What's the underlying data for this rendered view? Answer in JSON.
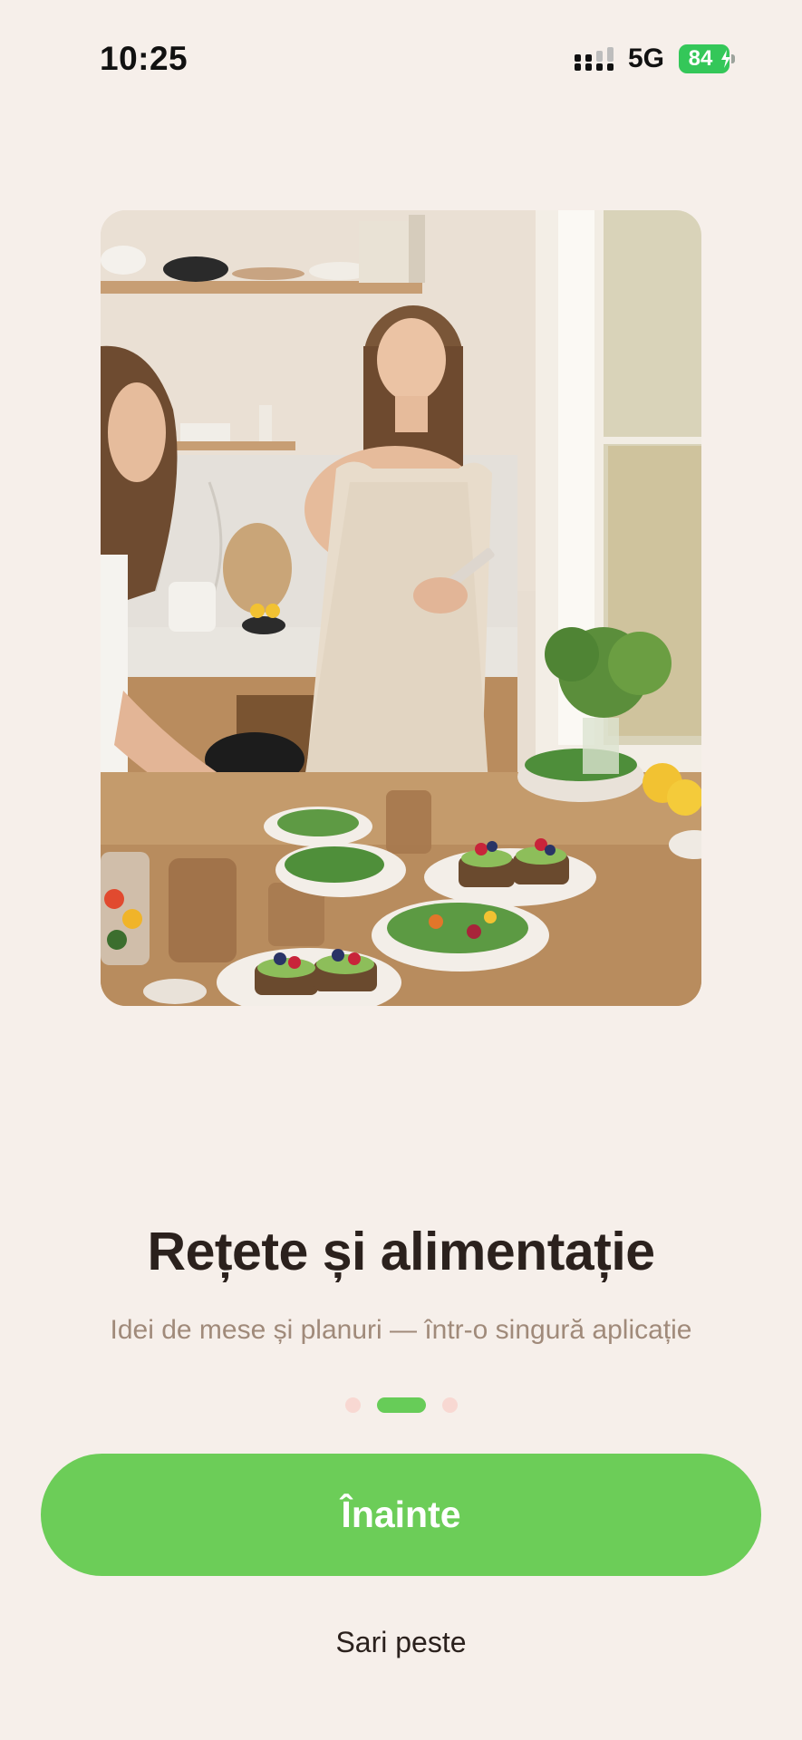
{
  "status_bar": {
    "time": "10:25",
    "network": "5G",
    "battery_level": "84",
    "icons": [
      "signal-bars-icon",
      "battery-charging-icon"
    ]
  },
  "hero": {
    "image": "photo-kitchen-meal-prep"
  },
  "onboarding": {
    "title": "Rețete și alimentație",
    "subtitle": "Idei de mese și planuri — într-o singură aplicație",
    "page_count": 3,
    "current_page": 2
  },
  "actions": {
    "next_label": "Înainte",
    "skip_label": "Sari peste"
  },
  "colors": {
    "background": "#F6EFEA",
    "accent": "#6CCD58",
    "title": "#2B211D",
    "subtitle": "#A08A7A",
    "inactive_dot": "#F8D8D2"
  }
}
